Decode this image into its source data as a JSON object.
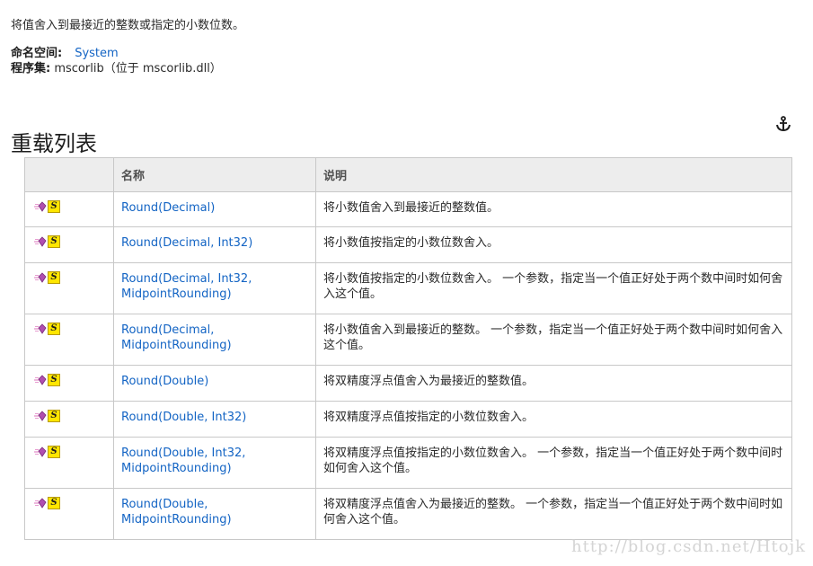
{
  "summary": "将值舍入到最接近的整数或指定的小数位数。",
  "namespace": {
    "label": "命名空间:",
    "value": "System"
  },
  "assembly": {
    "label": "程序集:",
    "value": "mscorlib（位于 mscorlib.dll）"
  },
  "section_title": "重载列表",
  "table": {
    "headers": [
      "",
      "名称",
      "说明"
    ],
    "rows": [
      {
        "name": "Round(Decimal)",
        "desc": "将小数值舍入到最接近的整数值。"
      },
      {
        "name": "Round(Decimal, Int32)",
        "desc": "将小数值按指定的小数位数舍入。"
      },
      {
        "name": "Round(Decimal, Int32, MidpointRounding)",
        "desc": "将小数值按指定的小数位数舍入。 一个参数，指定当一个值正好处于两个数中间时如何舍入这个值。"
      },
      {
        "name": "Round(Decimal, MidpointRounding)",
        "desc": "将小数值舍入到最接近的整数。 一个参数，指定当一个值正好处于两个数中间时如何舍入这个值。"
      },
      {
        "name": "Round(Double)",
        "desc": "将双精度浮点值舍入为最接近的整数值。"
      },
      {
        "name": "Round(Double, Int32)",
        "desc": "将双精度浮点值按指定的小数位数舍入。"
      },
      {
        "name": "Round(Double, Int32, MidpointRounding)",
        "desc": "将双精度浮点值按指定的小数位数舍入。 一个参数，指定当一个值正好处于两个数中间时如何舍入这个值。"
      },
      {
        "name": "Round(Double, MidpointRounding)",
        "desc": "将双精度浮点值舍入为最接近的整数。 一个参数，指定当一个值正好处于两个数中间时如何舍入这个值。"
      }
    ]
  },
  "icons": {
    "method": "public-method-icon",
    "static": "static-icon",
    "anchor": "anchor-icon"
  },
  "colors": {
    "link": "#1364c4",
    "header_bg": "#ededed",
    "border": "#c8c8c8",
    "static_badge": "#ffe600"
  },
  "watermark": "http://blog.csdn.net/Htojk"
}
